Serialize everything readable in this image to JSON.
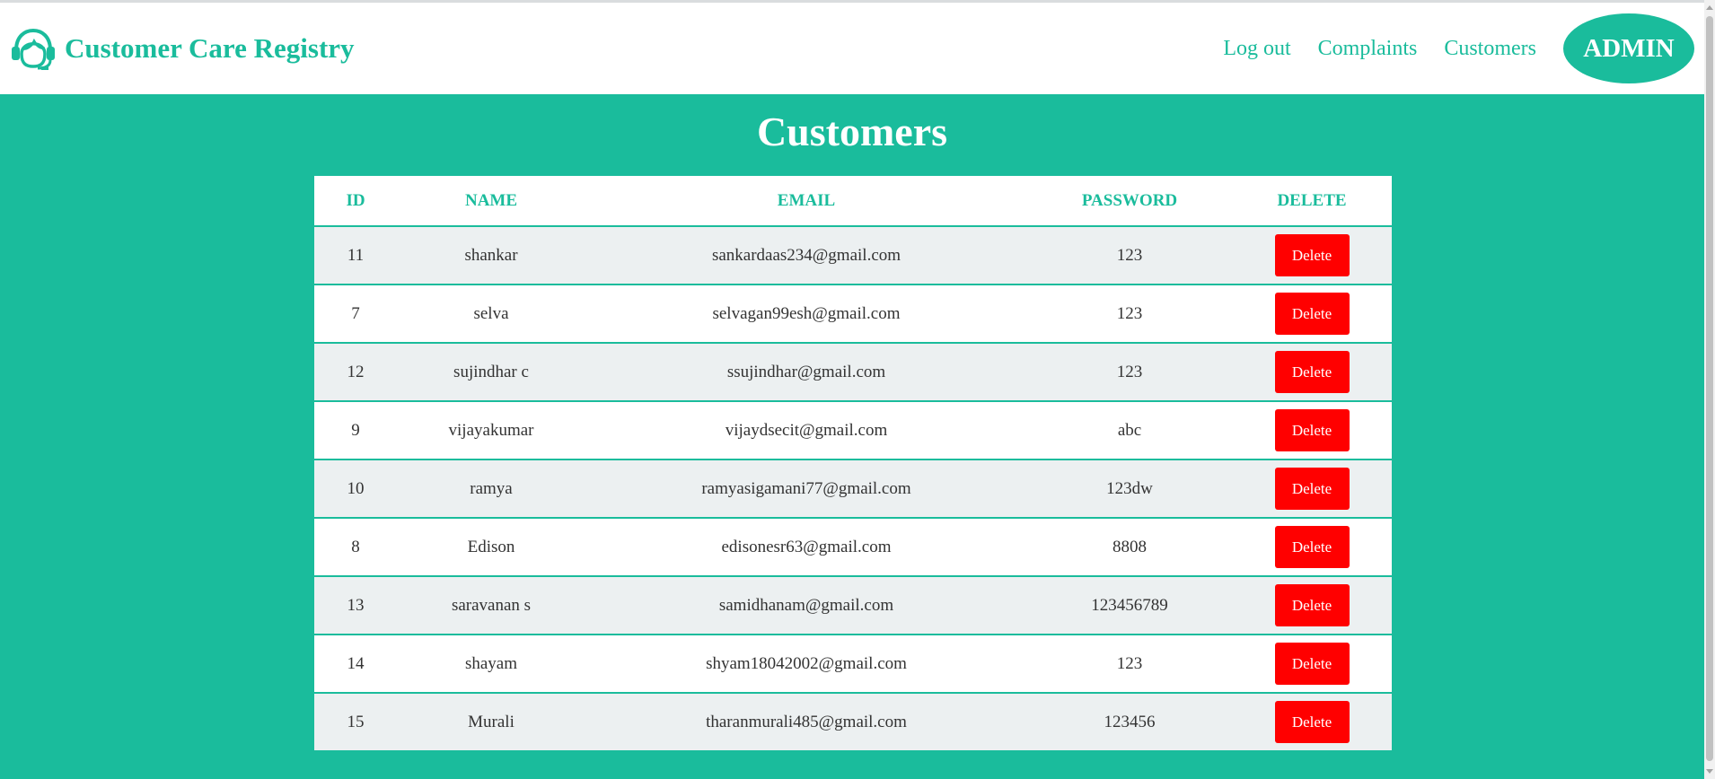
{
  "header": {
    "brand_title": "Customer Care Registry",
    "brand_icon": "headset-agent-icon",
    "nav": {
      "logout": "Log out",
      "complaints": "Complaints",
      "customers": "Customers"
    },
    "admin_badge": "ADMIN"
  },
  "page_title": "Customers",
  "table": {
    "columns": [
      "ID",
      "NAME",
      "EMAIL",
      "PASSWORD",
      "DELETE"
    ],
    "delete_label": "Delete",
    "rows": [
      {
        "id": "11",
        "name": "shankar",
        "email": "sankardaas234@gmail.com",
        "password": "123"
      },
      {
        "id": "7",
        "name": "selva",
        "email": "selvagan99esh@gmail.com",
        "password": "123"
      },
      {
        "id": "12",
        "name": "sujindhar c",
        "email": "ssujindhar@gmail.com",
        "password": "123"
      },
      {
        "id": "9",
        "name": "vijayakumar",
        "email": "vijaydsecit@gmail.com",
        "password": "abc"
      },
      {
        "id": "10",
        "name": "ramya",
        "email": "ramyasigamani77@gmail.com",
        "password": "123dw"
      },
      {
        "id": "8",
        "name": "Edison",
        "email": "edisonesr63@gmail.com",
        "password": "8808"
      },
      {
        "id": "13",
        "name": "saravanan s",
        "email": "samidhanam@gmail.com",
        "password": "123456789"
      },
      {
        "id": "14",
        "name": "shayam",
        "email": "shyam18042002@gmail.com",
        "password": "123"
      },
      {
        "id": "15",
        "name": "Murali",
        "email": "tharanmurali485@gmail.com",
        "password": "123456"
      }
    ]
  },
  "colors": {
    "accent": "#1abc9c",
    "delete": "#ff0000",
    "row_alt": "#ecf0f1"
  }
}
